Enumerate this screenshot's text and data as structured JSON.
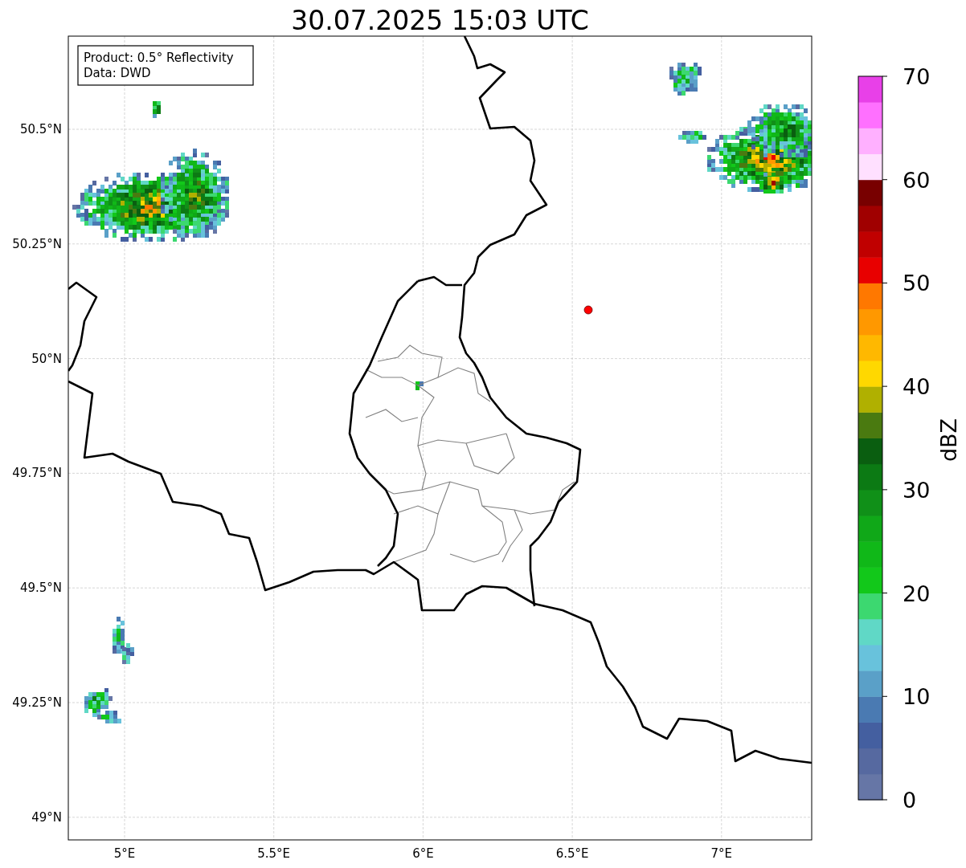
{
  "title": "30.07.2025 15:03 UTC",
  "info_box": {
    "lines": [
      "Product: 0.5° Reflectivity",
      "Data: DWD"
    ]
  },
  "map": {
    "x_ticks": [
      "5°E",
      "5.5°E",
      "6°E",
      "6.5°E",
      "7°E"
    ],
    "y_ticks": [
      "50.5°N",
      "50.25°N",
      "50°N",
      "49.75°N",
      "49.5°N",
      "49.25°N",
      "49°N"
    ]
  },
  "colorbar": {
    "label": "dBZ",
    "ticks": [
      "70",
      "60",
      "50",
      "40",
      "30",
      "20",
      "10",
      "0"
    ]
  }
}
